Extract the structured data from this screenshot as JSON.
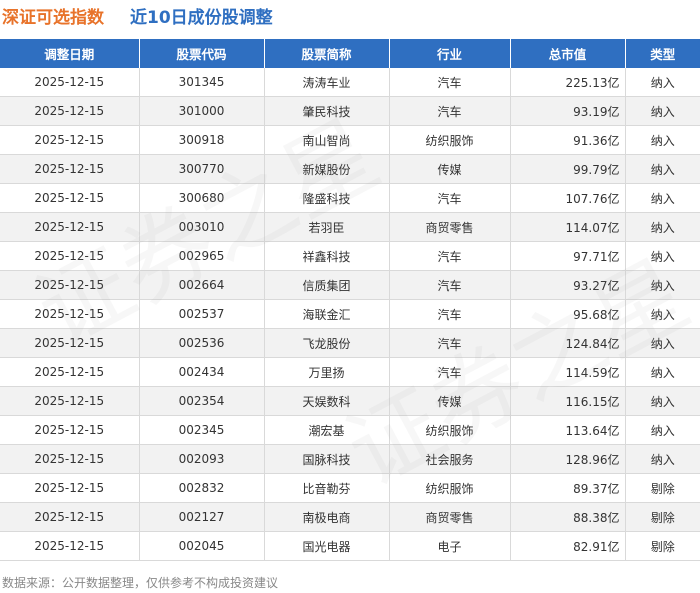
{
  "title": {
    "main": "深证可选指数",
    "sub": "近10日成份股调整"
  },
  "table": {
    "headers": [
      "调整日期",
      "股票代码",
      "股票简称",
      "行业",
      "总市值",
      "类型"
    ],
    "rows": [
      [
        "2025-12-15",
        "301345",
        "涛涛车业",
        "汽车",
        "225.13亿",
        "纳入"
      ],
      [
        "2025-12-15",
        "301000",
        "肇民科技",
        "汽车",
        "93.19亿",
        "纳入"
      ],
      [
        "2025-12-15",
        "300918",
        "南山智尚",
        "纺织服饰",
        "91.36亿",
        "纳入"
      ],
      [
        "2025-12-15",
        "300770",
        "新媒股份",
        "传媒",
        "99.79亿",
        "纳入"
      ],
      [
        "2025-12-15",
        "300680",
        "隆盛科技",
        "汽车",
        "107.76亿",
        "纳入"
      ],
      [
        "2025-12-15",
        "003010",
        "若羽臣",
        "商贸零售",
        "114.07亿",
        "纳入"
      ],
      [
        "2025-12-15",
        "002965",
        "祥鑫科技",
        "汽车",
        "97.71亿",
        "纳入"
      ],
      [
        "2025-12-15",
        "002664",
        "信质集团",
        "汽车",
        "93.27亿",
        "纳入"
      ],
      [
        "2025-12-15",
        "002537",
        "海联金汇",
        "汽车",
        "95.68亿",
        "纳入"
      ],
      [
        "2025-12-15",
        "002536",
        "飞龙股份",
        "汽车",
        "124.84亿",
        "纳入"
      ],
      [
        "2025-12-15",
        "002434",
        "万里扬",
        "汽车",
        "114.59亿",
        "纳入"
      ],
      [
        "2025-12-15",
        "002354",
        "天娱数科",
        "传媒",
        "116.15亿",
        "纳入"
      ],
      [
        "2025-12-15",
        "002345",
        "潮宏基",
        "纺织服饰",
        "113.64亿",
        "纳入"
      ],
      [
        "2025-12-15",
        "002093",
        "国脉科技",
        "社会服务",
        "128.96亿",
        "纳入"
      ],
      [
        "2025-12-15",
        "002832",
        "比音勒芬",
        "纺织服饰",
        "89.37亿",
        "剔除"
      ],
      [
        "2025-12-15",
        "002127",
        "南极电商",
        "商贸零售",
        "88.38亿",
        "剔除"
      ],
      [
        "2025-12-15",
        "002045",
        "国光电器",
        "电子",
        "82.91亿",
        "剔除"
      ]
    ]
  },
  "footer": "数据来源：公开数据整理，仅供参考不构成投资建议",
  "watermark": [
    "证券之星",
    "证券之星"
  ],
  "colors": {
    "title_main": "#e8732a",
    "title_sub": "#2f6fc1",
    "header_bg": "#2f6fc1",
    "stripe": "#f2f2f2"
  }
}
